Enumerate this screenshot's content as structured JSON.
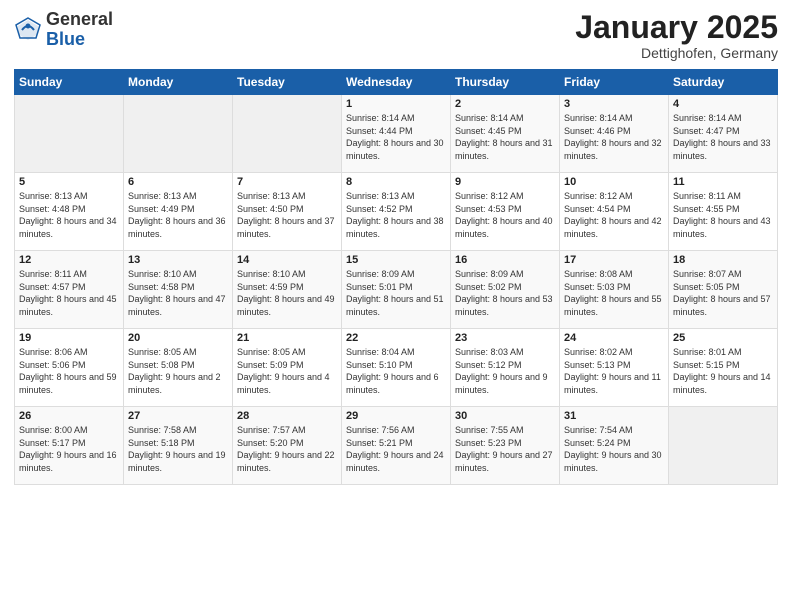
{
  "logo": {
    "general": "General",
    "blue": "Blue"
  },
  "title": "January 2025",
  "location": "Dettighofen, Germany",
  "weekdays": [
    "Sunday",
    "Monday",
    "Tuesday",
    "Wednesday",
    "Thursday",
    "Friday",
    "Saturday"
  ],
  "weeks": [
    [
      {
        "day": "",
        "sunrise": "",
        "sunset": "",
        "daylight": ""
      },
      {
        "day": "",
        "sunrise": "",
        "sunset": "",
        "daylight": ""
      },
      {
        "day": "",
        "sunrise": "",
        "sunset": "",
        "daylight": ""
      },
      {
        "day": "1",
        "sunrise": "Sunrise: 8:14 AM",
        "sunset": "Sunset: 4:44 PM",
        "daylight": "Daylight: 8 hours and 30 minutes."
      },
      {
        "day": "2",
        "sunrise": "Sunrise: 8:14 AM",
        "sunset": "Sunset: 4:45 PM",
        "daylight": "Daylight: 8 hours and 31 minutes."
      },
      {
        "day": "3",
        "sunrise": "Sunrise: 8:14 AM",
        "sunset": "Sunset: 4:46 PM",
        "daylight": "Daylight: 8 hours and 32 minutes."
      },
      {
        "day": "4",
        "sunrise": "Sunrise: 8:14 AM",
        "sunset": "Sunset: 4:47 PM",
        "daylight": "Daylight: 8 hours and 33 minutes."
      }
    ],
    [
      {
        "day": "5",
        "sunrise": "Sunrise: 8:13 AM",
        "sunset": "Sunset: 4:48 PM",
        "daylight": "Daylight: 8 hours and 34 minutes."
      },
      {
        "day": "6",
        "sunrise": "Sunrise: 8:13 AM",
        "sunset": "Sunset: 4:49 PM",
        "daylight": "Daylight: 8 hours and 36 minutes."
      },
      {
        "day": "7",
        "sunrise": "Sunrise: 8:13 AM",
        "sunset": "Sunset: 4:50 PM",
        "daylight": "Daylight: 8 hours and 37 minutes."
      },
      {
        "day": "8",
        "sunrise": "Sunrise: 8:13 AM",
        "sunset": "Sunset: 4:52 PM",
        "daylight": "Daylight: 8 hours and 38 minutes."
      },
      {
        "day": "9",
        "sunrise": "Sunrise: 8:12 AM",
        "sunset": "Sunset: 4:53 PM",
        "daylight": "Daylight: 8 hours and 40 minutes."
      },
      {
        "day": "10",
        "sunrise": "Sunrise: 8:12 AM",
        "sunset": "Sunset: 4:54 PM",
        "daylight": "Daylight: 8 hours and 42 minutes."
      },
      {
        "day": "11",
        "sunrise": "Sunrise: 8:11 AM",
        "sunset": "Sunset: 4:55 PM",
        "daylight": "Daylight: 8 hours and 43 minutes."
      }
    ],
    [
      {
        "day": "12",
        "sunrise": "Sunrise: 8:11 AM",
        "sunset": "Sunset: 4:57 PM",
        "daylight": "Daylight: 8 hours and 45 minutes."
      },
      {
        "day": "13",
        "sunrise": "Sunrise: 8:10 AM",
        "sunset": "Sunset: 4:58 PM",
        "daylight": "Daylight: 8 hours and 47 minutes."
      },
      {
        "day": "14",
        "sunrise": "Sunrise: 8:10 AM",
        "sunset": "Sunset: 4:59 PM",
        "daylight": "Daylight: 8 hours and 49 minutes."
      },
      {
        "day": "15",
        "sunrise": "Sunrise: 8:09 AM",
        "sunset": "Sunset: 5:01 PM",
        "daylight": "Daylight: 8 hours and 51 minutes."
      },
      {
        "day": "16",
        "sunrise": "Sunrise: 8:09 AM",
        "sunset": "Sunset: 5:02 PM",
        "daylight": "Daylight: 8 hours and 53 minutes."
      },
      {
        "day": "17",
        "sunrise": "Sunrise: 8:08 AM",
        "sunset": "Sunset: 5:03 PM",
        "daylight": "Daylight: 8 hours and 55 minutes."
      },
      {
        "day": "18",
        "sunrise": "Sunrise: 8:07 AM",
        "sunset": "Sunset: 5:05 PM",
        "daylight": "Daylight: 8 hours and 57 minutes."
      }
    ],
    [
      {
        "day": "19",
        "sunrise": "Sunrise: 8:06 AM",
        "sunset": "Sunset: 5:06 PM",
        "daylight": "Daylight: 8 hours and 59 minutes."
      },
      {
        "day": "20",
        "sunrise": "Sunrise: 8:05 AM",
        "sunset": "Sunset: 5:08 PM",
        "daylight": "Daylight: 9 hours and 2 minutes."
      },
      {
        "day": "21",
        "sunrise": "Sunrise: 8:05 AM",
        "sunset": "Sunset: 5:09 PM",
        "daylight": "Daylight: 9 hours and 4 minutes."
      },
      {
        "day": "22",
        "sunrise": "Sunrise: 8:04 AM",
        "sunset": "Sunset: 5:10 PM",
        "daylight": "Daylight: 9 hours and 6 minutes."
      },
      {
        "day": "23",
        "sunrise": "Sunrise: 8:03 AM",
        "sunset": "Sunset: 5:12 PM",
        "daylight": "Daylight: 9 hours and 9 minutes."
      },
      {
        "day": "24",
        "sunrise": "Sunrise: 8:02 AM",
        "sunset": "Sunset: 5:13 PM",
        "daylight": "Daylight: 9 hours and 11 minutes."
      },
      {
        "day": "25",
        "sunrise": "Sunrise: 8:01 AM",
        "sunset": "Sunset: 5:15 PM",
        "daylight": "Daylight: 9 hours and 14 minutes."
      }
    ],
    [
      {
        "day": "26",
        "sunrise": "Sunrise: 8:00 AM",
        "sunset": "Sunset: 5:17 PM",
        "daylight": "Daylight: 9 hours and 16 minutes."
      },
      {
        "day": "27",
        "sunrise": "Sunrise: 7:58 AM",
        "sunset": "Sunset: 5:18 PM",
        "daylight": "Daylight: 9 hours and 19 minutes."
      },
      {
        "day": "28",
        "sunrise": "Sunrise: 7:57 AM",
        "sunset": "Sunset: 5:20 PM",
        "daylight": "Daylight: 9 hours and 22 minutes."
      },
      {
        "day": "29",
        "sunrise": "Sunrise: 7:56 AM",
        "sunset": "Sunset: 5:21 PM",
        "daylight": "Daylight: 9 hours and 24 minutes."
      },
      {
        "day": "30",
        "sunrise": "Sunrise: 7:55 AM",
        "sunset": "Sunset: 5:23 PM",
        "daylight": "Daylight: 9 hours and 27 minutes."
      },
      {
        "day": "31",
        "sunrise": "Sunrise: 7:54 AM",
        "sunset": "Sunset: 5:24 PM",
        "daylight": "Daylight: 9 hours and 30 minutes."
      },
      {
        "day": "",
        "sunrise": "",
        "sunset": "",
        "daylight": ""
      }
    ]
  ]
}
